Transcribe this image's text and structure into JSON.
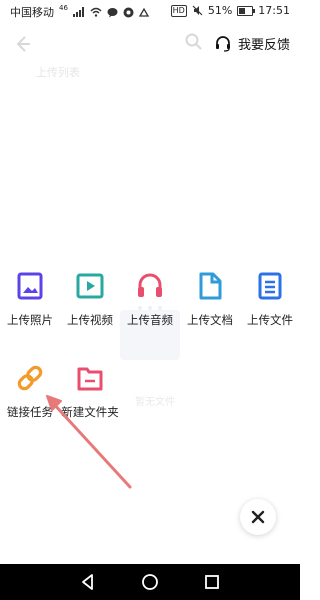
{
  "status_bar": {
    "carrier": "中国移动",
    "network": "46",
    "hd": "HD",
    "battery": "51%",
    "battery_level": 0.51,
    "time": "17:51"
  },
  "header": {
    "feedback_label": "我要反馈"
  },
  "background": {
    "faded_title": "上传列表",
    "faded_empty_text": "暂无文件"
  },
  "actions": [
    {
      "label": "上传照片",
      "icon": "photo-icon",
      "color": "#5B43E8"
    },
    {
      "label": "上传视频",
      "icon": "video-icon",
      "color": "#27A8A0"
    },
    {
      "label": "上传音频",
      "icon": "audio-icon",
      "color": "#E84F6E"
    },
    {
      "label": "上传文档",
      "icon": "document-icon",
      "color": "#2F9BD9"
    },
    {
      "label": "上传文件",
      "icon": "file-icon",
      "color": "#2B72E6"
    },
    {
      "label": "链接任务",
      "icon": "link-icon",
      "color": "#F39A2A"
    },
    {
      "label": "新建文件夹",
      "icon": "folder-icon",
      "color": "#E84F6E"
    }
  ],
  "annotation": {
    "arrow_color": "#E87979"
  }
}
